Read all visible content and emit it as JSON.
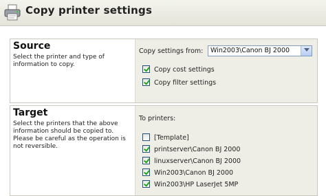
{
  "header": {
    "title": "Copy printer settings",
    "icon": "printer-icon"
  },
  "source": {
    "title": "Source",
    "description": "Select the printer and type of information to copy.",
    "copy_from_label": "Copy settings from:",
    "copy_from_value": "Win2003\\Canon BJ 2000",
    "options": [
      {
        "label": "Copy cost settings",
        "checked": true
      },
      {
        "label": "Copy filter settings",
        "checked": true
      }
    ]
  },
  "target": {
    "title": "Target",
    "description": "Select the printers that the above information should be copied to. Please be careful as the operation is not reversible.",
    "to_printers_label": "To printers:",
    "printers": [
      {
        "label": "[Template]",
        "checked": false
      },
      {
        "label": "printserver\\Canon BJ 2000",
        "checked": true
      },
      {
        "label": "linuxserver\\Canon BJ 2000",
        "checked": true
      },
      {
        "label": "Win2003\\Canon BJ 2000",
        "checked": true
      },
      {
        "label": "Win2003\\HP LaserJet 5MP",
        "checked": true
      }
    ]
  }
}
